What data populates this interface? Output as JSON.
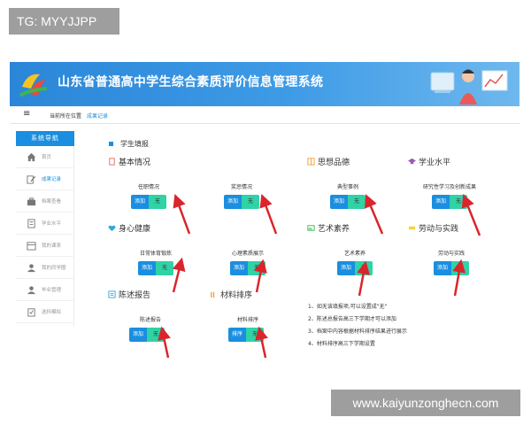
{
  "watermark_top": "TG: MYYJJPP",
  "watermark_bottom": "www.kaiyunzonghecn.com",
  "header": {
    "title": "山东省普通高中学生综合素质评价信息管理系统"
  },
  "topbar": {
    "menu_icon": "≡",
    "location_label": "当前所在位置",
    "current": "成果记录"
  },
  "sidebar": {
    "title": "系统导航",
    "items": [
      {
        "label": "首页",
        "icon": "home-icon"
      },
      {
        "label": "成果记录",
        "icon": "edit-icon",
        "active": true
      },
      {
        "label": "档案查看",
        "icon": "briefcase-icon"
      },
      {
        "label": "学业水平",
        "icon": "document-icon"
      },
      {
        "label": "我的课表",
        "icon": "calendar-icon"
      },
      {
        "label": "我的同学圈",
        "icon": "people-icon"
      },
      {
        "label": "毕业管理",
        "icon": "graduation-icon"
      },
      {
        "label": "选科模拟",
        "icon": "clipboard-icon"
      }
    ]
  },
  "main": {
    "title": "学生填报",
    "sections": {
      "basic": "基本情况",
      "moral": "思想品德",
      "academic": "学业水平",
      "health": "身心健康",
      "arts": "艺术素养",
      "labor": "劳动与实践",
      "report": "陈述报告",
      "sort": "材料排序"
    },
    "cards": [
      {
        "label": "任职情况",
        "left": "添加",
        "right": "无"
      },
      {
        "label": "奖惩情况",
        "left": "添加",
        "right": "无"
      },
      {
        "label": "典型事例",
        "left": "添加",
        "right": "无"
      },
      {
        "label": "研究性学习及创新成果",
        "left": "添加",
        "right": "无"
      },
      {
        "label": "日常体育锻炼",
        "left": "添加",
        "right": "无"
      },
      {
        "label": "心理素质展示",
        "left": "添加",
        "right": "无"
      },
      {
        "label": "艺术素养",
        "left": "添加",
        "right": "无"
      },
      {
        "label": "劳动与实践",
        "left": "添加",
        "right": "无"
      },
      {
        "label": "陈述报告",
        "left": "添加",
        "right": "无"
      },
      {
        "label": "材料排序",
        "left": "排序",
        "right": "无"
      }
    ],
    "notes": [
      "1、如无该填报项,可以设置成\"无\"",
      "2、陈述总报告高三下学期才可以添加",
      "3、档案中内容根据材料排序结果进行展示",
      "4、材料排序高三下学期设置"
    ]
  },
  "colors": {
    "primary": "#1a8ee0",
    "none_button": "#2fd3a6",
    "arrow": "#d9262c"
  }
}
